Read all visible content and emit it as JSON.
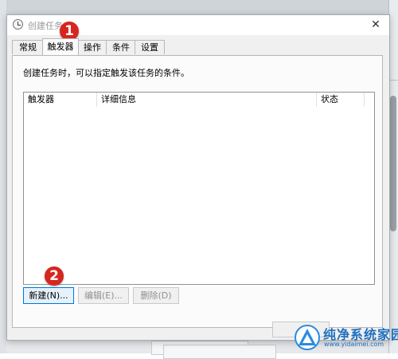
{
  "window": {
    "title": "创建任务",
    "close_glyph": "✕"
  },
  "tabs": [
    {
      "label": "常规",
      "active": false
    },
    {
      "label": "触发器",
      "active": true
    },
    {
      "label": "操作",
      "active": false
    },
    {
      "label": "条件",
      "active": false
    },
    {
      "label": "设置",
      "active": false
    }
  ],
  "panel": {
    "description": "创建任务时，可以指定触发该任务的条件。"
  },
  "list": {
    "columns": [
      "触发器",
      "详细信息",
      "状态"
    ],
    "rows": []
  },
  "buttons": {
    "new": "新建(N)...",
    "edit": "编辑(E)...",
    "delete": "删除(D)"
  },
  "annotations": {
    "step1": "1",
    "step2": "2",
    "color": "#d7261e"
  },
  "watermark": {
    "title": "纯净系统家园",
    "url": "www.yidaimei.com"
  }
}
